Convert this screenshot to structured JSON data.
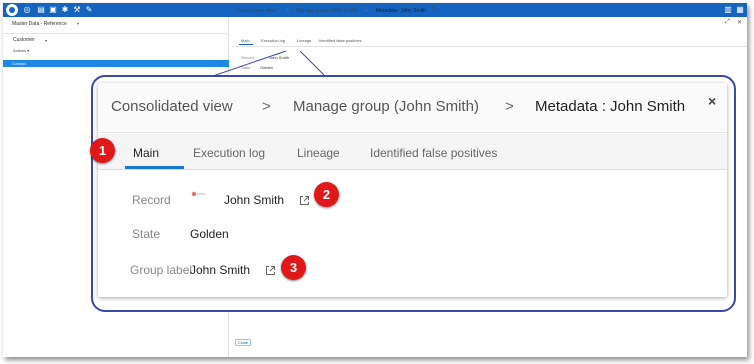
{
  "app": {
    "module_title": "Master Data - Reference",
    "entity": "Customer",
    "actions_label": "Actions",
    "selected_item": "Contact"
  },
  "header": {
    "breadcrumbs": [
      "Consolidated view",
      "Manage group (John Smith)",
      "Metadata : John Smith"
    ],
    "separator": ">"
  },
  "tabs": [
    "Main",
    "Execution log",
    "Lineage",
    "Identified false positives"
  ],
  "fields": {
    "record_label": "Record",
    "record_value": "John Smith",
    "state_label": "State",
    "state_value": "Golden",
    "group_label": "Group label",
    "group_value": "John Smith"
  },
  "footer": {
    "close_label": "Close"
  },
  "zoom_close_glyph": "×",
  "badges": [
    "1",
    "2",
    "3"
  ],
  "colors": {
    "topbar": "#1565c0",
    "accent": "#1976d2",
    "callout_border": "#3949ab",
    "badge": "#e01818"
  }
}
